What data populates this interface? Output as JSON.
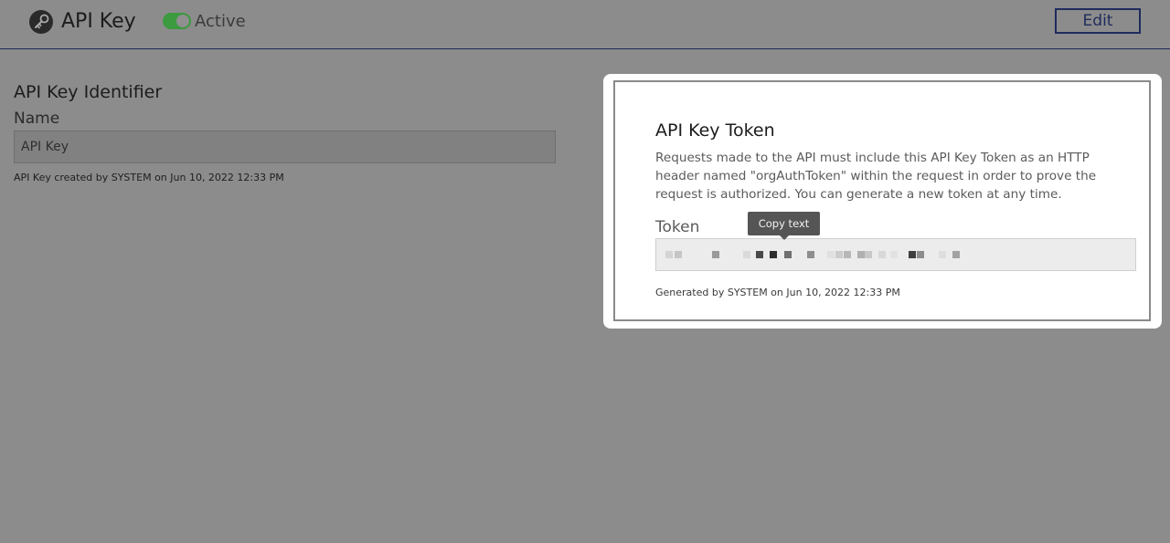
{
  "header": {
    "title": "API Key",
    "icon": "key-icon",
    "status": "Active",
    "status_on": true,
    "edit_label": "Edit",
    "accent_color": "#1f2b5c",
    "toggle_color": "#3c9a3f"
  },
  "identifier": {
    "section_title": "API Key Identifier",
    "name_label": "Name",
    "name_value": "API Key",
    "created_meta": "API Key created by SYSTEM on Jun 10, 2022 12:33 PM"
  },
  "token_card": {
    "title": "API Key Token",
    "description": "Requests made to the API must include this API Key Token as an HTTP header named \"orgAuthToken\" within the request in order to prove the request is authorized. You can generate a new token at any time.",
    "token_label": "Token",
    "tooltip": "Copy text",
    "generated_meta": "Generated by SYSTEM on Jun 10, 2022 12:33 PM"
  }
}
